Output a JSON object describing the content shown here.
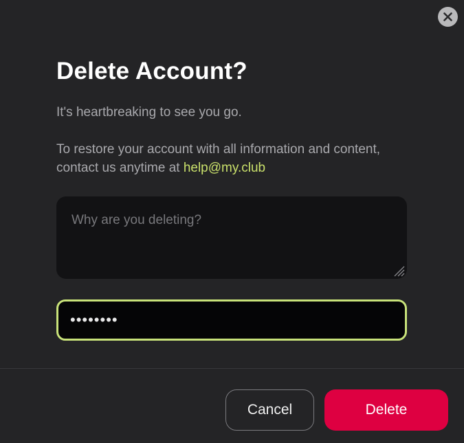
{
  "dialog": {
    "close_icon": "close-icon",
    "title": "Delete Account?",
    "subtitle": "It's heartbreaking to see you go.",
    "restore_text": "To restore your account with all information and content, contact us anytime at",
    "support_email": "help@my.club"
  },
  "form": {
    "reason_placeholder": "Why are you deleting?",
    "reason_value": "",
    "password_value": "••••••••",
    "password_masked_length": 8
  },
  "actions": {
    "cancel_label": "Cancel",
    "delete_label": "Delete"
  },
  "colors": {
    "background": "#242426",
    "accent": "#c9e37a",
    "danger": "#de0041",
    "input_background": "#121214"
  }
}
